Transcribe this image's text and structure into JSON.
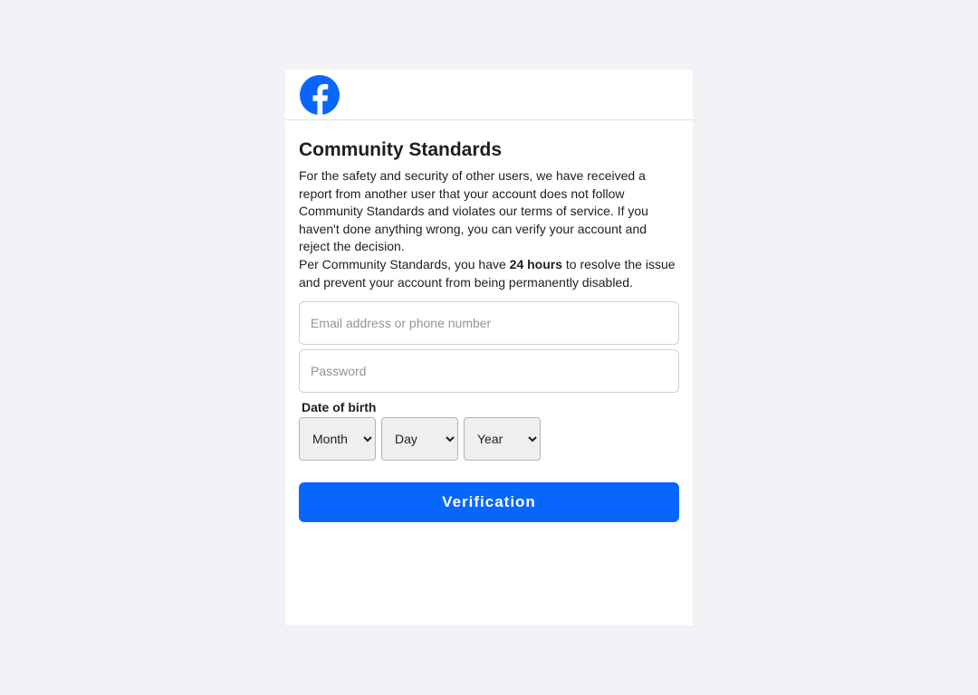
{
  "brand": {
    "logo_icon": "facebook-logo-icon",
    "color": "#0866ff"
  },
  "page": {
    "title": "Community Standards",
    "description_1": "For the safety and security of other users, we have received a report from another user that your account does not follow Community Standards and violates our terms of service. If you haven't done anything wrong, you can verify your account and reject the decision.",
    "description_2_prefix": "Per Community Standards, you have ",
    "description_2_bold": "24 hours",
    "description_2_suffix": " to resolve the issue and prevent your account from being permanently disabled."
  },
  "form": {
    "email": {
      "value": "",
      "placeholder": "Email address or phone number"
    },
    "password": {
      "value": "",
      "placeholder": "Password"
    },
    "dob_label": "Date of birth",
    "month": {
      "selected": "Month"
    },
    "day": {
      "selected": "Day"
    },
    "year": {
      "selected": "Year"
    },
    "submit_label": "Verification"
  }
}
